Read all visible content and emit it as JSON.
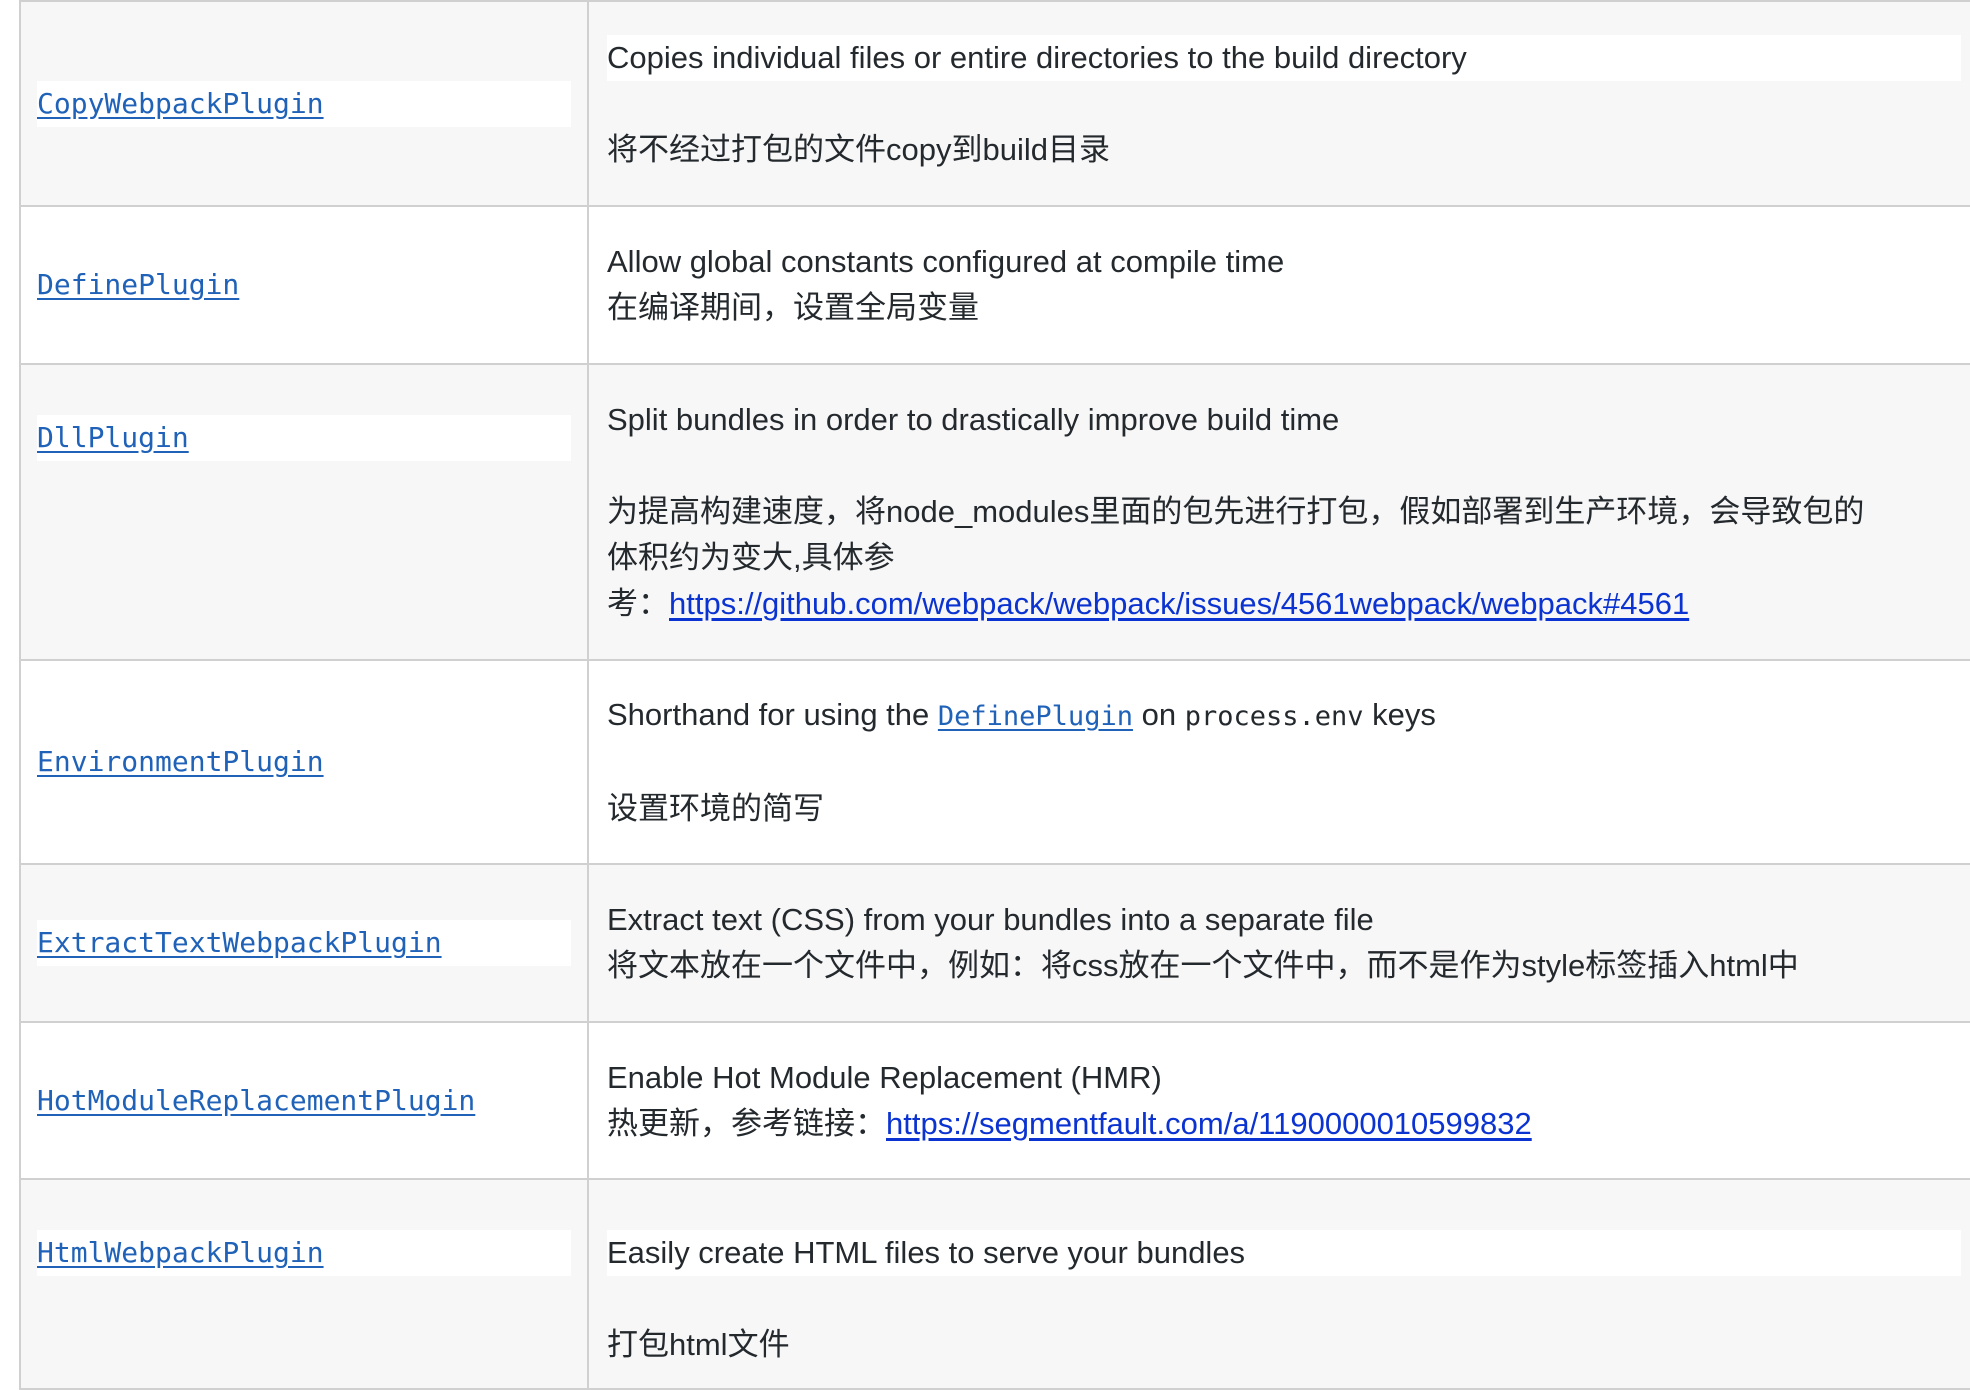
{
  "rows": [
    {
      "name": "CopyWebpackPlugin",
      "en": "Copies individual files or entire directories to the build directory",
      "cn": "将不经过打包的文件copy到build目录"
    },
    {
      "name": "DefinePlugin",
      "en": "Allow global constants configured at compile time",
      "cn": "在编译期间，设置全局变量"
    },
    {
      "name": "DllPlugin",
      "en": "Split bundles in order to drastically improve build time",
      "cn_line1": "为提高构建速度，将node_modules里面的包先进行打包，假如部署到生产环境，会导致包的",
      "cn_line2": "体积约为变大,具体参",
      "cn_prefix": "考：",
      "cn_link": "https://github.com/webpack/webpack/issues/4561webpack/webpack#4561"
    },
    {
      "name": "EnvironmentPlugin",
      "en_prefix": "Shorthand for using the ",
      "en_code_link": "DefinePlugin",
      "en_mid": " on ",
      "en_code": "process.env",
      "en_suffix": " keys",
      "cn": "设置环境的简写"
    },
    {
      "name": "ExtractTextWebpackPlugin",
      "en": "Extract text (CSS) from your bundles into a separate file",
      "cn": "将文本放在一个文件中，例如：将css放在一个文件中，而不是作为style标签插入html中"
    },
    {
      "name": "HotModuleReplacementPlugin",
      "en": "Enable Hot Module Replacement (HMR)",
      "cn_prefix": "热更新，参考链接：",
      "cn_link": "https://segmentfault.com/a/1190000010599832"
    },
    {
      "name": "HtmlWebpackPlugin",
      "en": "Easily create HTML files to serve your bundles",
      "cn": "打包html文件"
    }
  ]
}
